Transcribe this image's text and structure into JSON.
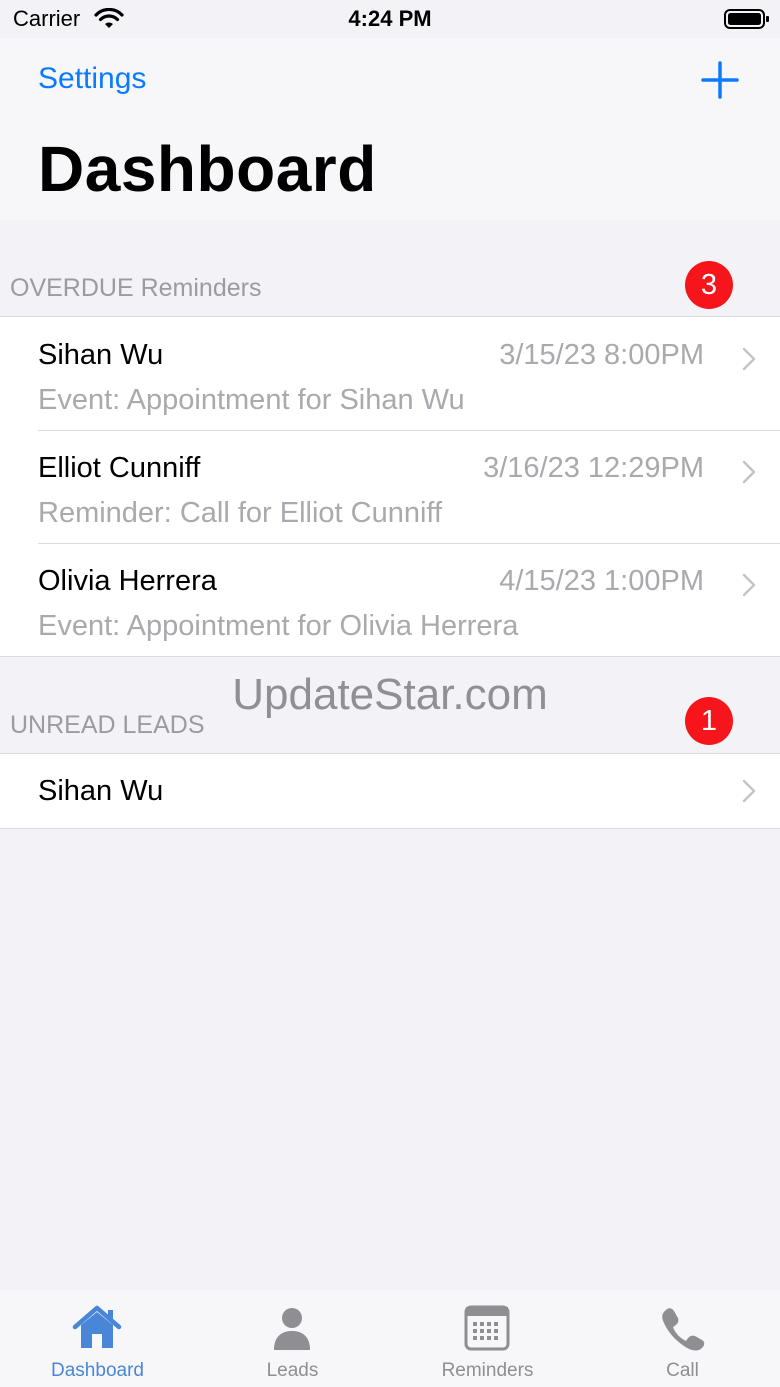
{
  "status_bar": {
    "carrier": "Carrier",
    "time": "4:24 PM"
  },
  "nav": {
    "settings_label": "Settings",
    "add_icon": "plus-icon",
    "title": "Dashboard"
  },
  "overdue": {
    "header": "OVERDUE Reminders",
    "count": "3",
    "items": [
      {
        "name": "Sihan Wu",
        "date": "3/15/23 8:00PM",
        "detail": "Event: Appointment for Sihan Wu"
      },
      {
        "name": "Elliot Cunniff",
        "date": "3/16/23 12:29PM",
        "detail": "Reminder: Call for Elliot Cunniff"
      },
      {
        "name": "Olivia Herrera",
        "date": "4/15/23 1:00PM",
        "detail": "Event: Appointment for Olivia Herrera"
      }
    ]
  },
  "unread": {
    "header": "UNREAD LEADS",
    "count": "1",
    "items": [
      {
        "name": "Sihan Wu"
      }
    ]
  },
  "watermark": "UpdateStar.com",
  "tabs": [
    {
      "label": "Dashboard",
      "icon": "house-icon",
      "active": true
    },
    {
      "label": "Leads",
      "icon": "person-icon",
      "active": false
    },
    {
      "label": "Reminders",
      "icon": "calendar-icon",
      "active": false
    },
    {
      "label": "Call",
      "icon": "phone-icon",
      "active": false
    }
  ],
  "colors": {
    "accent": "#0a7aff",
    "badge": "#f5151a",
    "tab_active": "#4a86d8",
    "tab_inactive": "#8e8e93"
  }
}
